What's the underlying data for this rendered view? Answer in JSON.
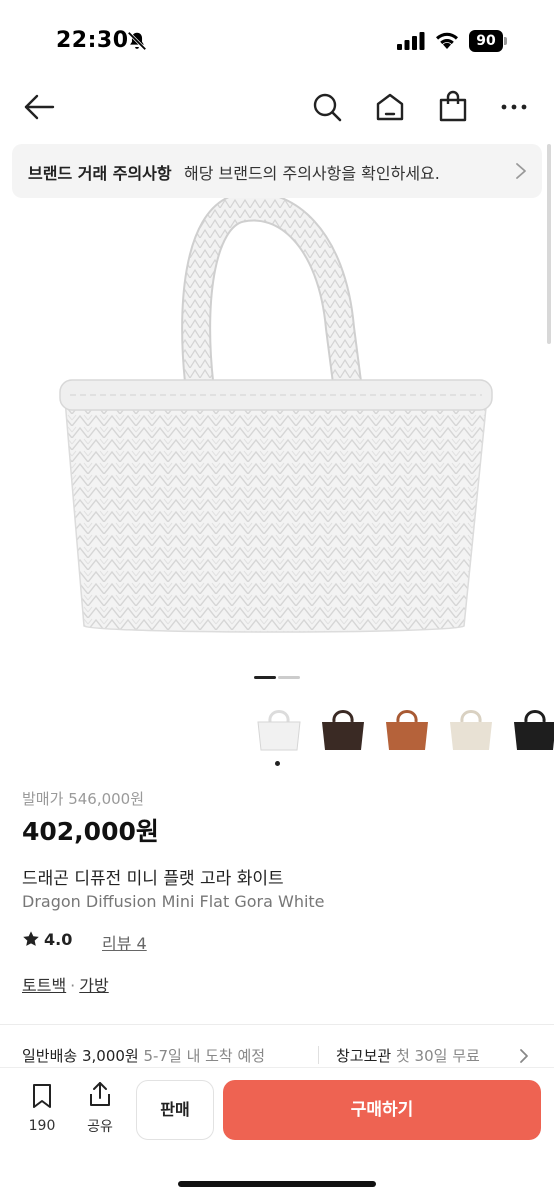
{
  "status_bar": {
    "time": "22:30",
    "battery": "90"
  },
  "nav": {
    "icons": [
      "back-arrow-icon",
      "search-icon",
      "home-icon",
      "shopping-bag-icon",
      "more-icon"
    ]
  },
  "notice": {
    "title": "브랜드 거래 주의사항",
    "text": "해당 브랜드의 주의사항을 확인하세요."
  },
  "gallery": {
    "current_page": 1,
    "total_pages": 2
  },
  "thumbnails": [
    {
      "color_name": "white",
      "hex": "#f1f1f1"
    },
    {
      "color_name": "black-brown",
      "hex": "#3a2a24"
    },
    {
      "color_name": "tan",
      "hex": "#b5623a"
    },
    {
      "color_name": "cream",
      "hex": "#e8e1d4"
    },
    {
      "color_name": "black",
      "hex": "#1e1e1e"
    }
  ],
  "product": {
    "original_price_label": "발매가",
    "original_price": "546,000원",
    "price": "402,000원",
    "name_ko": "드래곤 디퓨전 미니 플랫 고라 화이트",
    "name_en": "Dragon Diffusion Mini Flat Gora White",
    "rating": "4.0",
    "review_label": "리뷰 4",
    "categories": [
      "토트백",
      "가방"
    ]
  },
  "shipping": {
    "label": "일반배송 3,000원",
    "sub": "5-7일 내 도착 예정",
    "storage_label": "창고보관",
    "storage_sub": "첫 30일 무료"
  },
  "bottom_bar": {
    "wishlist_count": "190",
    "share_label": "공유",
    "sell_label": "판매",
    "buy_label": "구매하기"
  },
  "colors": {
    "accent": "#ee6352",
    "muted": "#9a9a9a",
    "notice_bg": "#f4f4f4"
  }
}
